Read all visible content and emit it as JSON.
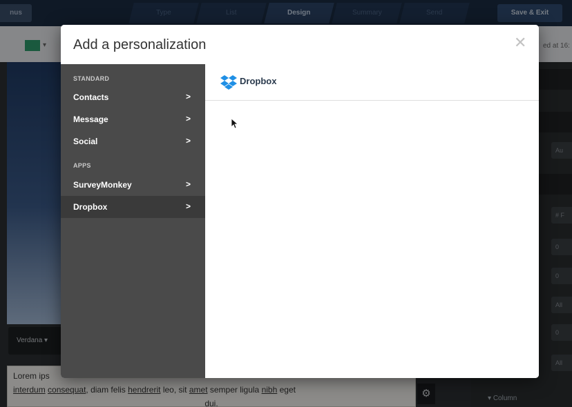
{
  "background": {
    "back_label": "nus",
    "steps": [
      "Type",
      "List",
      "Design",
      "Summary",
      "Send"
    ],
    "active_step": "Design",
    "save_exit_label": "Save & Exit",
    "saved_text": "ed at 16:",
    "font_select": "Verdana",
    "editor_line1": "Lorem ips",
    "editor_line2_words": [
      "interdum",
      "consequat",
      ", diam felis ",
      "hendrerit",
      " leo, sit ",
      "amet",
      " semper ligula ",
      "nibh",
      " eget"
    ],
    "editor_line3": "dui.",
    "right_panel_rows": [
      "Au",
      "# F",
      "0",
      "0",
      "All",
      "0",
      "All"
    ],
    "column_label": "Column"
  },
  "modal": {
    "title": "Add a personalization",
    "close_icon": "close-icon",
    "sidebar": {
      "standard_label": "STANDARD",
      "apps_label": "APPS",
      "standard_items": [
        {
          "label": "Contacts",
          "chevron": ">"
        },
        {
          "label": "Message",
          "chevron": ">"
        },
        {
          "label": "Social",
          "chevron": ">"
        }
      ],
      "app_items": [
        {
          "label": "SurveyMonkey",
          "chevron": ">"
        },
        {
          "label": "Dropbox",
          "chevron": ">"
        }
      ],
      "active_item": "Dropbox"
    },
    "content": {
      "app_name": "Dropbox",
      "app_icon": "dropbox-icon"
    }
  },
  "colors": {
    "sidebar_bg": "#4a4a4a",
    "sidebar_active": "#3a3a3a",
    "dropbox_blue": "#1f8fe5"
  }
}
